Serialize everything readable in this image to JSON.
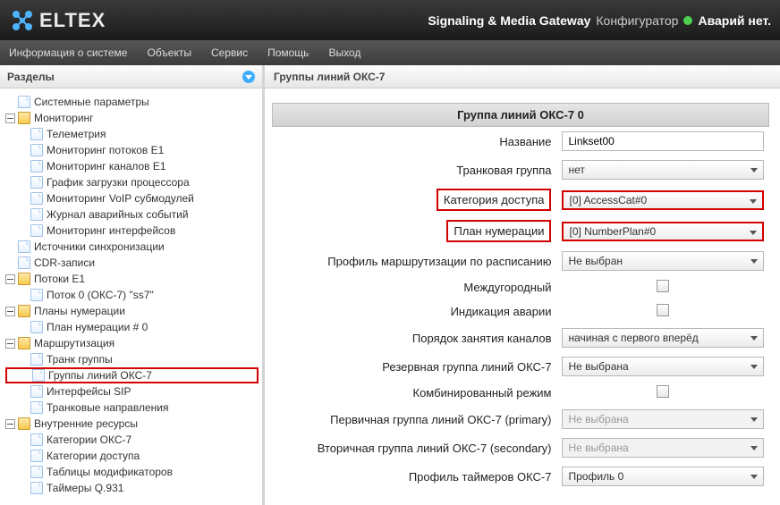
{
  "header": {
    "brand": "ELTEX",
    "product": "Signaling & Media Gateway",
    "subtitle": "Конфигуратор",
    "status": "Аварий нет."
  },
  "menu": [
    "Информация о системе",
    "Объекты",
    "Сервис",
    "Помощь",
    "Выход"
  ],
  "sidebar": {
    "title": "Разделы",
    "items": [
      {
        "t": "page",
        "pad": 0,
        "label": "Системные параметры"
      },
      {
        "t": "folder",
        "pad": 0,
        "tgl": "minus",
        "label": "Мониторинг"
      },
      {
        "t": "page",
        "pad": 2,
        "label": "Телеметрия"
      },
      {
        "t": "page",
        "pad": 2,
        "label": "Мониторинг потоков E1"
      },
      {
        "t": "page",
        "pad": 2,
        "label": "Мониторинг каналов E1"
      },
      {
        "t": "page",
        "pad": 2,
        "label": "График загрузки процессора"
      },
      {
        "t": "page",
        "pad": 2,
        "label": "Мониторинг VoIP субмодулей"
      },
      {
        "t": "page",
        "pad": 2,
        "label": "Журнал аварийных событий"
      },
      {
        "t": "page",
        "pad": 2,
        "label": "Мониторинг интерфейсов"
      },
      {
        "t": "page",
        "pad": 0,
        "label": "Источники синхронизации"
      },
      {
        "t": "page",
        "pad": 0,
        "label": "CDR-записи"
      },
      {
        "t": "folder",
        "pad": 0,
        "tgl": "minus",
        "label": "Потоки E1"
      },
      {
        "t": "page",
        "pad": 2,
        "label": "Поток 0 (ОКС-7) \"ss7\""
      },
      {
        "t": "folder",
        "pad": 0,
        "tgl": "minus",
        "label": "Планы нумерации"
      },
      {
        "t": "page",
        "pad": 2,
        "label": "План нумерации # 0"
      },
      {
        "t": "folder",
        "pad": 0,
        "tgl": "minus",
        "label": "Маршрутизация"
      },
      {
        "t": "page",
        "pad": 2,
        "label": "Транк группы"
      },
      {
        "t": "page",
        "pad": 2,
        "label": "Группы линий ОКС-7",
        "hl": true
      },
      {
        "t": "page",
        "pad": 2,
        "label": "Интерфейсы SIP"
      },
      {
        "t": "page",
        "pad": 2,
        "label": "Транковые направления"
      },
      {
        "t": "folder",
        "pad": 0,
        "tgl": "minus",
        "label": "Внутренние ресурсы"
      },
      {
        "t": "page",
        "pad": 2,
        "label": "Категории ОКС-7"
      },
      {
        "t": "page",
        "pad": 2,
        "label": "Категории доступа"
      },
      {
        "t": "page",
        "pad": 2,
        "label": "Таблицы модификаторов"
      },
      {
        "t": "page",
        "pad": 2,
        "label": "Таймеры Q.931"
      }
    ]
  },
  "main": {
    "title": "Группы линий ОКС-7",
    "form_title": "Группа линий ОКС-7 0",
    "rows": [
      {
        "label": "Название",
        "type": "text",
        "value": "Linkset00"
      },
      {
        "label": "Транковая группа",
        "type": "select",
        "value": "нет"
      },
      {
        "label": "Категория доступа",
        "type": "select",
        "value": "[0] AccessCat#0",
        "red": true
      },
      {
        "label": "План нумерации",
        "type": "select",
        "value": "[0] NumberPlan#0",
        "red": true
      },
      {
        "label": "Профиль маршрутизации по расписанию",
        "type": "select",
        "value": "Не выбран"
      },
      {
        "label": "Междугородный",
        "type": "check"
      },
      {
        "label": "Индикация аварии",
        "type": "check"
      },
      {
        "label": "Порядок занятия каналов",
        "type": "select",
        "value": "начиная с первого вперёд"
      },
      {
        "label": "Резервная группа линий ОКС-7",
        "type": "select",
        "value": "Не выбрана"
      },
      {
        "label": "Комбинированный режим",
        "type": "check"
      },
      {
        "label": "Первичная группа линий ОКС-7 (primary)",
        "type": "select",
        "value": "Не выбрана",
        "disabled": true
      },
      {
        "label": "Вторичная группа линий ОКС-7 (secondary)",
        "type": "select",
        "value": "Не выбрана",
        "disabled": true
      },
      {
        "label": "Профиль таймеров ОКС-7",
        "type": "select",
        "value": "Профиль 0"
      }
    ]
  }
}
